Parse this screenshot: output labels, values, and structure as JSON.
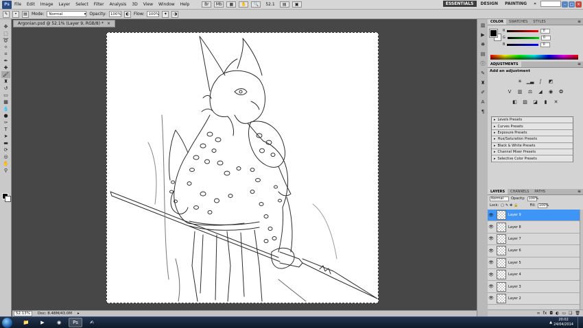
{
  "menu": {
    "items": [
      "File",
      "Edit",
      "Image",
      "Layer",
      "Select",
      "Filter",
      "Analysis",
      "3D",
      "View",
      "Window",
      "Help"
    ],
    "zoom": "52.1",
    "logo": "Ps"
  },
  "workspaces": [
    "ESSENTIALS",
    "DESIGN",
    "PAINTING",
    "»"
  ],
  "options": {
    "mode_label": "Mode:",
    "mode_value": "Normal",
    "opacity_label": "Opacity:",
    "opacity_value": "100%",
    "flow_label": "Flow:",
    "flow_value": "100%"
  },
  "document": {
    "tab_title": "Argonian.psd @ 52.1% (Layer 9, RGB/8) *",
    "tab_close": "×"
  },
  "status": {
    "zoom": "52.13%",
    "doc": "Doc: 8.48M/43.0M"
  },
  "color_panel": {
    "tabs": [
      "COLOR",
      "SWATCHES",
      "STYLES"
    ],
    "channels": [
      {
        "label": "R",
        "value": "0"
      },
      {
        "label": "G",
        "value": "0"
      },
      {
        "label": "B",
        "value": "0"
      }
    ]
  },
  "adjustments": {
    "tab": "ADJUSTMENTS",
    "title": "Add an adjustment",
    "presets": [
      "Levels Presets",
      "Curves Presets",
      "Exposure Presets",
      "Hue/Saturation Presets",
      "Black & White Presets",
      "Channel Mixer Presets",
      "Selective Color Presets"
    ]
  },
  "layers_panel": {
    "tabs": [
      "LAYERS",
      "CHANNELS",
      "PATHS"
    ],
    "blend_mode": "Normal",
    "opacity_label": "Opacity:",
    "opacity_value": "100%",
    "lock_label": "Lock:",
    "fill_label": "Fill:",
    "fill_value": "100%",
    "layers": [
      "Layer 9",
      "Layer 8",
      "Layer 7",
      "Layer 6",
      "Layer 5",
      "Layer 4",
      "Layer 3",
      "Layer 2"
    ],
    "selected_index": 0
  },
  "taskbar": {
    "time": "20:02",
    "date": "24/04/2014"
  },
  "colors": {
    "accent_selection": "#3f95f5",
    "workspace_active": "#3d3d3d",
    "canvas_bg": "#474747"
  }
}
